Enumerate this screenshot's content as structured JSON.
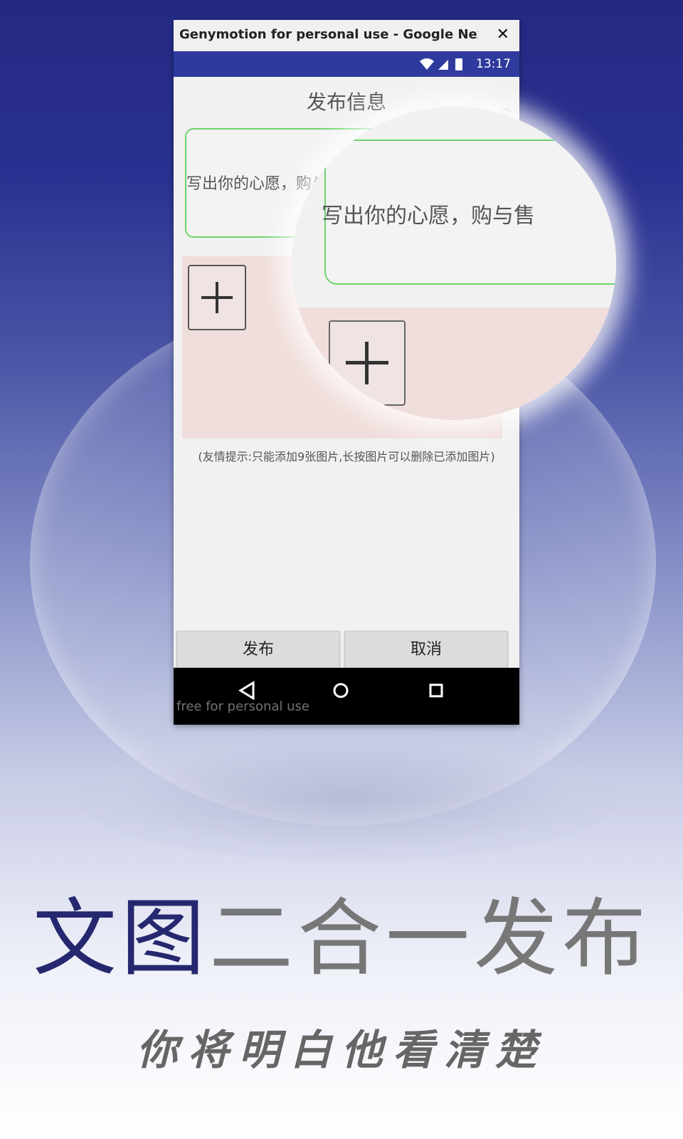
{
  "window": {
    "title": "Genymotion for personal use - Google Nexus ...",
    "close_icon": "close-icon",
    "close_glyph": "✕"
  },
  "status_bar": {
    "time": "13:17",
    "icons": [
      "wifi-icon",
      "signal-icon",
      "battery-icon"
    ],
    "color": "#2f3a9e"
  },
  "app": {
    "title": "发布信息",
    "text_input": {
      "placeholder": "写出你的心愿，购与售",
      "value": ""
    },
    "image_area": {
      "add_button_icon": "plus-icon",
      "color": "#f0dedc"
    },
    "hint": "(友情提示:只能添加9张图片,长按图片可以删除已添加图片)",
    "buttons": {
      "publish": "发布",
      "cancel": "取消"
    }
  },
  "nav_bar": {
    "items": [
      "back-icon",
      "home-icon",
      "recents-icon"
    ],
    "watermark": "free for personal use"
  },
  "magnifier": {
    "text": "写出你的心愿，购与售"
  },
  "promo": {
    "headline_blue": "文图",
    "headline_gray": "二合一发布",
    "tagline": "你将明白他看清楚"
  }
}
